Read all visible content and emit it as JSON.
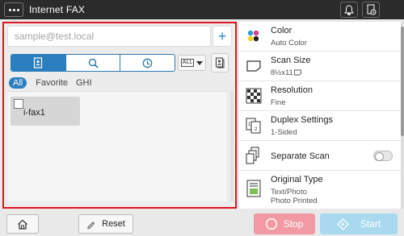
{
  "app": {
    "title": "Internet FAX"
  },
  "address": {
    "placeholder": "sample@test.local",
    "add_label": "+"
  },
  "sort": {
    "label": "ALL"
  },
  "filters": [
    "All",
    "Favorite",
    "GHI"
  ],
  "destinations": [
    {
      "name": "i-fax1"
    }
  ],
  "settings": [
    {
      "label": "Color",
      "value": "Auto Color"
    },
    {
      "label": "Scan Size",
      "value": "8½x11"
    },
    {
      "label": "Resolution",
      "value": "Fine"
    },
    {
      "label": "Duplex Settings",
      "value": "1-Sided"
    },
    {
      "label": "Separate Scan",
      "value": ""
    },
    {
      "label": "Original Type",
      "value": "Text/Photo",
      "value2": "Photo Printed"
    }
  ],
  "bottom": {
    "reset_label": "Reset",
    "stop_label": "Stop",
    "start_label": "Start"
  },
  "colors": {
    "accent": "#2b7fbf",
    "highlight_border": "#e0141e",
    "stop": "#f19aa4",
    "start": "#a9d9ef",
    "titlebar": "#2b2b2b"
  },
  "icons": [
    "menu-icon",
    "bell-icon",
    "job-status-icon",
    "address-book-icon",
    "search-icon",
    "history-icon",
    "sort-icon",
    "book-icon",
    "color-icon",
    "paper-size-icon",
    "resolution-icon",
    "duplex-icon",
    "separate-scan-icon",
    "original-type-icon",
    "home-icon",
    "reset-icon",
    "stop-icon",
    "start-icon"
  ]
}
